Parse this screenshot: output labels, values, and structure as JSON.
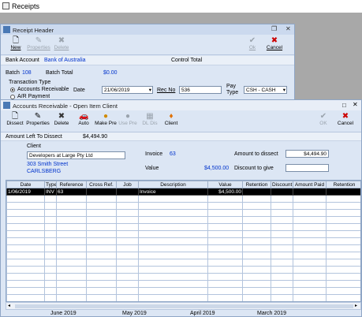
{
  "app": {
    "title": "Receipts"
  },
  "receipt_header": {
    "title": "Receipt Header",
    "toolbar": {
      "new": "New",
      "properties": "Properties",
      "delete": "Delete",
      "ok": "Ok",
      "cancel": "Cancel"
    },
    "bank_account_label": "Bank Account",
    "bank_account_value": "Bank of Australia",
    "control_total_label": "Control Total",
    "batch_label": "Batch",
    "batch_value": "108",
    "batch_total_label": "Batch Total",
    "batch_total_value": "$0.00",
    "transaction_type_label": "Transaction Type",
    "tt_option1": "Accounts Receivable",
    "tt_option2": "A/R Payment",
    "date_label": "Date",
    "date_value": "21/06/2019",
    "rec_no_label": "Rec No",
    "rec_no_value": "536",
    "pay_type_label": "Pay Type",
    "pay_type_value": "CSH - CASH"
  },
  "ar": {
    "title": "Accounts Receivable - Open Item Client",
    "toolbar": {
      "dissect": "Dissect",
      "properties": "Properties",
      "delete": "Delete",
      "auto": "Auto",
      "make_pre": "Make Pre",
      "use_pre": "Use Pre",
      "dl_dis": "DL Dis",
      "client": "Client",
      "ok": "OK",
      "cancel": "Cancel"
    },
    "amount_left_label": "Amount Left To Dissect",
    "amount_left_value": "$4,494.90",
    "client_label": "Client",
    "client_value": "Developers at Large Pty Ltd",
    "address1": "303 Smith Street",
    "address2": "CARLSBERG",
    "invoice_label": "Invoice",
    "invoice_value": "63",
    "value_label": "Value",
    "value_value": "$4,500.00",
    "amount_to_dissect_label": "Amount to dissect",
    "amount_to_dissect_value": "$4,494.90",
    "discount_label": "Discount to give",
    "discount_value": "",
    "grid": {
      "columns": [
        "Date",
        "Type",
        "Reference",
        "Cross Ref.",
        "Job",
        "Description",
        "Value",
        "Retention",
        "Discount",
        "Amount Paid",
        "Retention"
      ],
      "rows": [
        [
          "1/06/2019",
          "INV",
          "63",
          "",
          "",
          "Invoice",
          "$4,500.00",
          "",
          "",
          "",
          ""
        ]
      ]
    }
  },
  "calendar_months": [
    "June 2019",
    "May 2019",
    "April 2019",
    "March 2019"
  ],
  "colors": {
    "accent_blue": "#0033cc",
    "window_bg": "#dce6f4",
    "mdi_bg": "#a8a8a8"
  }
}
